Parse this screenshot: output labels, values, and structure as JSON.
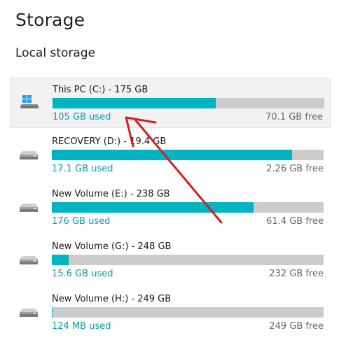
{
  "page": {
    "title": "Storage",
    "section_title": "Local storage"
  },
  "colors": {
    "bar_fill": "#00b4c1",
    "bar_track": "#cccccc",
    "used_text": "#0a9aad",
    "arrow": "#d32020"
  },
  "drives": [
    {
      "name": "This PC (C:) - 175 GB",
      "used": "105 GB used",
      "free": "70.1 GB free",
      "used_fraction": 0.6,
      "icon": "windows-drive-icon",
      "selected": true
    },
    {
      "name": "RECOVERY (D:) - 19.4 GB",
      "used": "17.1 GB used",
      "free": "2.26 GB free",
      "used_fraction": 0.883,
      "icon": "hard-drive-icon",
      "selected": false
    },
    {
      "name": "New Volume (E:) - 238 GB",
      "used": "176 GB used",
      "free": "61.4 GB free",
      "used_fraction": 0.742,
      "icon": "hard-drive-icon",
      "selected": false
    },
    {
      "name": "New Volume (G:) - 248 GB",
      "used": "15.6 GB used",
      "free": "232 GB free",
      "used_fraction": 0.063,
      "icon": "hard-drive-icon",
      "selected": false
    },
    {
      "name": "New Volume (H:) - 249 GB",
      "used": "124 MB used",
      "free": "249 GB free",
      "used_fraction": 0.0005,
      "icon": "hard-drive-icon",
      "selected": false
    }
  ]
}
